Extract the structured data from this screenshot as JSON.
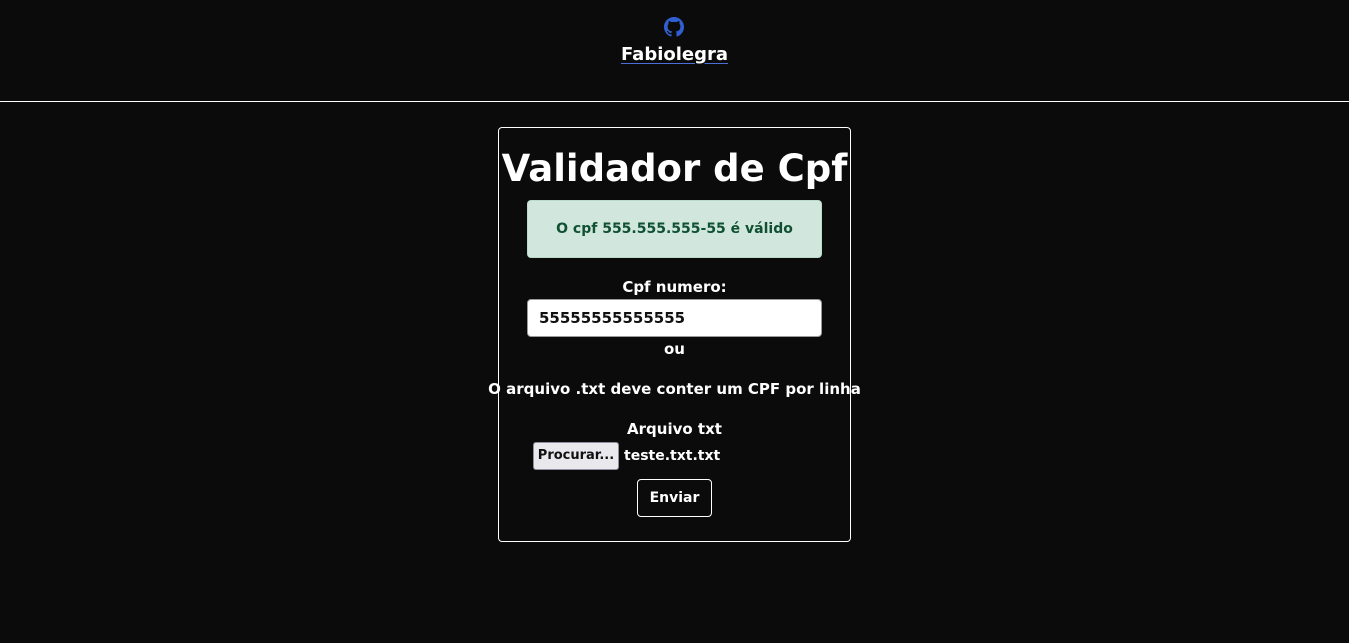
{
  "header": {
    "github_icon": "github-icon",
    "link_text": "Fabiolegra",
    "link_color": "#4a6fd8"
  },
  "card": {
    "title": "Validador de Cpf",
    "alert": {
      "text": "O cpf 555.555.555-55 é válido",
      "bg_color": "#d1e7dd",
      "text_color": "#0f5132"
    },
    "cpf_label": "Cpf numero:",
    "cpf_value": "55555555555555",
    "or_text": "ou",
    "file_hint": "O arquivo .txt deve conter um CPF por linha",
    "file_label": "Arquivo txt",
    "file_button": "Procurar...",
    "file_name": "teste.txt.txt",
    "submit_label": "Enviar"
  }
}
